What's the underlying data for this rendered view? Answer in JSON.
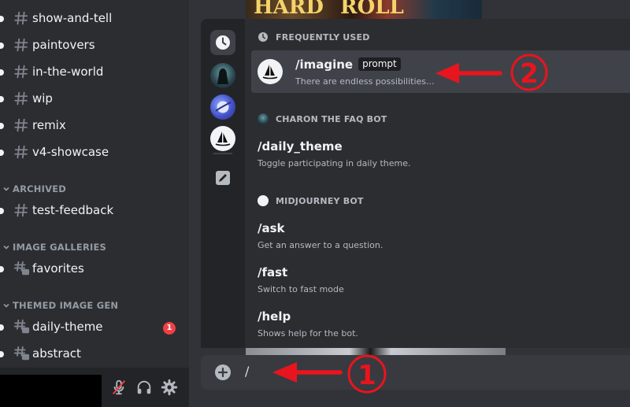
{
  "sidebar": {
    "channels_top": [
      {
        "name": "show-and-tell"
      },
      {
        "name": "paintovers"
      },
      {
        "name": "in-the-world"
      },
      {
        "name": "wip"
      },
      {
        "name": "remix"
      },
      {
        "name": "v4-showcase"
      }
    ],
    "cat_archived": "ARCHIVED",
    "archived_channels": [
      {
        "name": "test-feedback"
      }
    ],
    "cat_galleries": "IMAGE GALLERIES",
    "gallery_channels": [
      {
        "name": "favorites"
      }
    ],
    "cat_themed": "THEMED IMAGE GEN",
    "themed_channels": [
      {
        "name": "daily-theme",
        "badge": "1"
      },
      {
        "name": "abstract"
      }
    ]
  },
  "userbar": {
    "icons": [
      "mic-muted-icon",
      "headphones-icon",
      "gear-icon"
    ]
  },
  "background_image": {
    "text_left": "HARD",
    "text_right": "ROLL"
  },
  "popup": {
    "rail_icons": [
      "clock-icon",
      "charon-bot-avatar",
      "planet-app-icon",
      "midjourney-bot-avatar",
      "pencil-icon"
    ],
    "sections": {
      "frequent": {
        "title": "FREQUENTLY USED",
        "commands": [
          {
            "name": "/imagine",
            "param": "prompt",
            "desc": "There are endless possibilities..."
          }
        ]
      },
      "charon": {
        "title": "CHARON THE FAQ BOT",
        "commands": [
          {
            "name": "/daily_theme",
            "desc": "Toggle participating in daily theme."
          }
        ]
      },
      "midjourney": {
        "title": "MIDJOURNEY BOT",
        "commands": [
          {
            "name": "/ask",
            "desc": "Get an answer to a question."
          },
          {
            "name": "/fast",
            "desc": "Switch to fast mode"
          },
          {
            "name": "/help",
            "desc": "Shows help for the bot."
          }
        ]
      }
    }
  },
  "input": {
    "value": "/"
  },
  "annotations": {
    "step1": "1",
    "step2": "2",
    "color": "#e8141e"
  },
  "colors": {
    "background": "#313338",
    "sidebar": "#2b2d31",
    "rail": "#232428",
    "selected_row": "#404249",
    "badge": "#f23f43",
    "input": "#383a40"
  }
}
